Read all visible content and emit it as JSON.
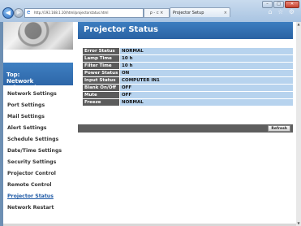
{
  "browser": {
    "address": "http://192.168.1.10/html/projectorstatus.html",
    "search_icon": "search-icon",
    "search_text": "ρ - c ×",
    "tab_title": "Projector Setup",
    "tab_close": "×",
    "back": "◀",
    "forward": "▶",
    "right_icons": "⌂ ☆ ⚙",
    "window_buttons": [
      "–",
      "□",
      "✕"
    ]
  },
  "sidebar": {
    "top_line1": "Top:",
    "top_line2": "Network Information",
    "items": [
      {
        "label": "Network Settings"
      },
      {
        "label": "Port Settings"
      },
      {
        "label": "Mail Settings"
      },
      {
        "label": "Alert Settings"
      },
      {
        "label": "Schedule Settings"
      },
      {
        "label": "Date/Time Settings"
      },
      {
        "label": "Security Settings"
      },
      {
        "label": "Projector Control"
      },
      {
        "label": "Remote Control"
      },
      {
        "label": "Projector Status"
      },
      {
        "label": "Network Restart"
      }
    ]
  },
  "main": {
    "title": "Projector Status",
    "status_rows": [
      {
        "key": "Error Status",
        "value": "NORMAL"
      },
      {
        "key": "Lamp Time",
        "value": "10 h"
      },
      {
        "key": "Filter Time",
        "value": "10 h"
      },
      {
        "key": "Power Status",
        "value": "ON"
      },
      {
        "key": "Input Status",
        "value": "COMPUTER IN1"
      },
      {
        "key": "Blank On/Off",
        "value": "OFF"
      },
      {
        "key": "Mute",
        "value": "OFF"
      },
      {
        "key": "Freeze",
        "value": "NORMAL"
      }
    ],
    "refresh_label": "Refresh"
  },
  "scrollbar": {
    "up": "▲",
    "down": "▼"
  }
}
